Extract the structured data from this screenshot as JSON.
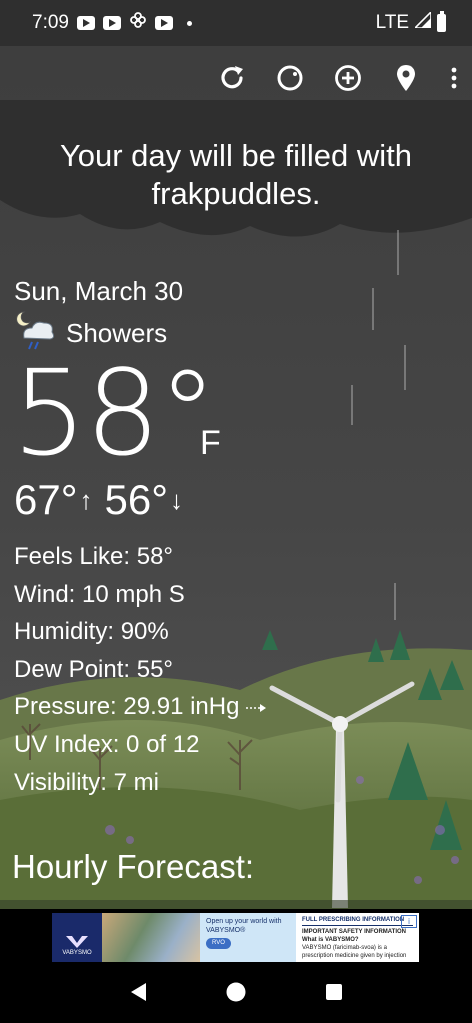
{
  "status_bar": {
    "time": "7:09",
    "network": "LTE"
  },
  "toolbar": {
    "icons": [
      "refresh-icon",
      "theme-icon",
      "add-location-icon",
      "location-pin-icon",
      "more-vert-icon"
    ]
  },
  "headline": "Your day will be filled with frakpuddles.",
  "weather": {
    "date": "Sun, March 30",
    "condition": "Showers",
    "temperature": "58°",
    "unit": "F",
    "high": "67°",
    "low": "56°",
    "feels_like": "Feels Like:  58°",
    "wind": "Wind:  10 mph S",
    "humidity": "Humidity:  90%",
    "dew_point": "Dew Point:  55°",
    "pressure": "Pressure:  29.91 inHg",
    "uv_index": "UV Index:  0 of 12",
    "visibility": "Visibility:  7 mi"
  },
  "hourly_title": "Hourly Forecast:",
  "ad": {
    "brand": "VABYSMO",
    "mid_text": "Open up your world with VABYSMO®",
    "cta": "RVO",
    "title": "FULL PRESCRIBING INFORMATION",
    "subtitle": "IMPORTANT SAFETY INFORMATION",
    "question": "What is VABYSMO?",
    "body": "VABYSMO (faricimab-svoa) is a prescription medicine given by injection",
    "info": "i"
  },
  "colors": {
    "sky": "#3b3b3b",
    "status_bar": "#2f2f2f",
    "grass": "#667a44",
    "tree": "#2f6e4c",
    "ad_brand": "#1a2a6a"
  }
}
